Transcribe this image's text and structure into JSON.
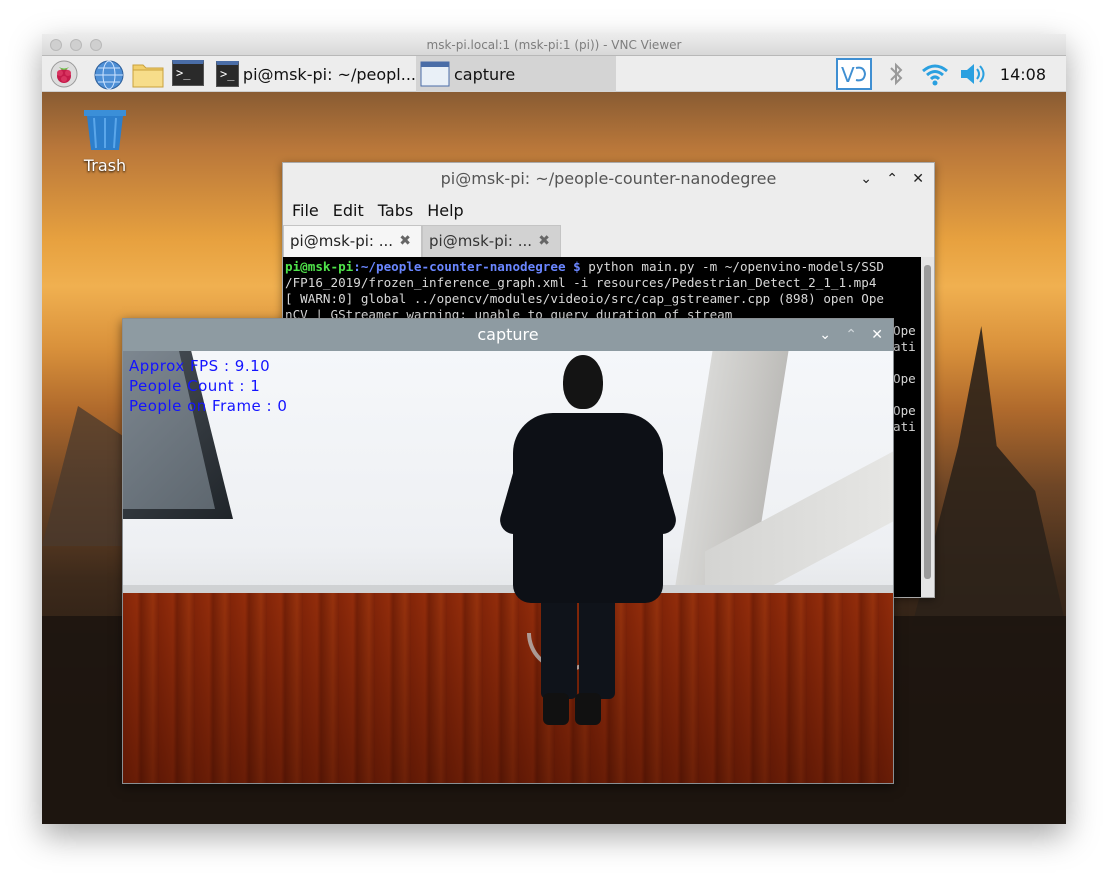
{
  "vnc": {
    "title": "msk-pi.local:1 (msk-pi:1 (pi)) - VNC Viewer"
  },
  "taskbar": {
    "tasks": [
      {
        "label": "pi@msk-pi: ~/peopl..."
      },
      {
        "label": "capture"
      }
    ],
    "clock": "14:08",
    "vnc_label": "V2"
  },
  "desktop": {
    "trash_label": "Trash"
  },
  "terminal": {
    "title": "pi@msk-pi: ~/people-counter-nanodegree",
    "menu": [
      "File",
      "Edit",
      "Tabs",
      "Help"
    ],
    "tabs": [
      "pi@msk-pi: ...",
      "pi@msk-pi: ..."
    ],
    "prompt_user": "pi@msk-pi",
    "prompt_path": ":~/people-counter-nanodegree $",
    "command": " python main.py -m ~/openvino-models/SSD",
    "lines": [
      "/FP16_2019/frozen_inference_graph.xml -i resources/Pedestrian_Detect_2_1_1.mp4",
      "[ WARN:0] global ../opencv/modules/videoio/src/cap_gstreamer.cpp (898) open Ope",
      "nCV | GStreamer warning: unable to query duration of stream",
      "Ope",
      "ati",
      "",
      "Ope",
      "",
      "Ope",
      "ati"
    ]
  },
  "capture": {
    "title": "capture",
    "overlay": [
      "Approx FPS : 9.10",
      "People Count : 1",
      "People on Frame : 0"
    ]
  }
}
